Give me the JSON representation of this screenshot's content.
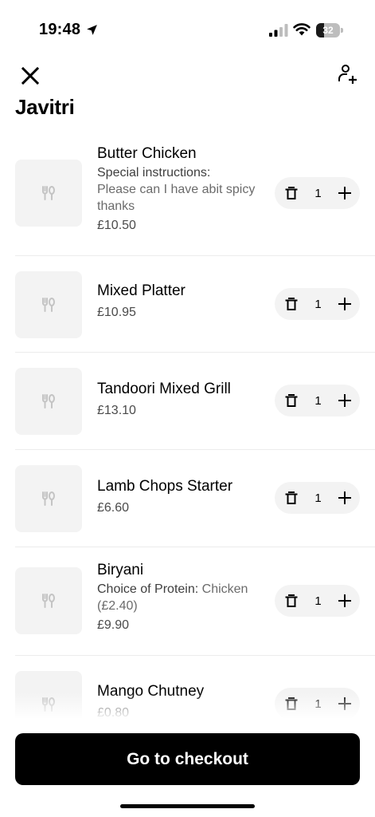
{
  "status_bar": {
    "time": "19:48",
    "battery": "32",
    "battery_level": 0.32
  },
  "header": {
    "title": "Javitri"
  },
  "items": [
    {
      "name": "Butter Chicken",
      "details": [
        {
          "label": "Special instructions:",
          "value": "Please can I have abit spicy thanks"
        }
      ],
      "price": "£10.50",
      "quantity": "1"
    },
    {
      "name": "Mixed Platter",
      "details": [],
      "price": "£10.95",
      "quantity": "1"
    },
    {
      "name": "Tandoori Mixed Grill",
      "details": [],
      "price": "£13.10",
      "quantity": "1"
    },
    {
      "name": "Lamb Chops Starter",
      "details": [],
      "price": "£6.60",
      "quantity": "1"
    },
    {
      "name": "Biryani",
      "details": [
        {
          "label": "Choice of Protein:",
          "value": "Chicken (£2.40)"
        }
      ],
      "price": "£9.90",
      "quantity": "1"
    },
    {
      "name": "Mango Chutney",
      "details": [],
      "price": "£0.80",
      "quantity": "1"
    }
  ],
  "checkout": {
    "label": "Go to checkout"
  }
}
